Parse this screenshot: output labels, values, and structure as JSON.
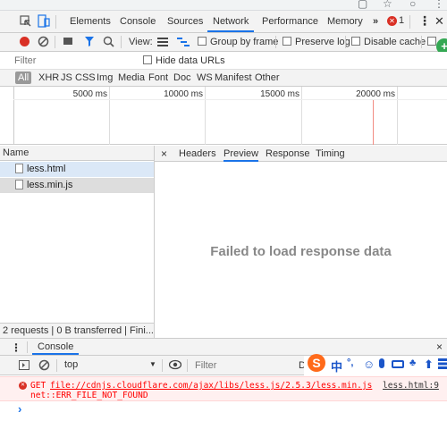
{
  "chrome": {
    "star_icon": "star",
    "account_icon": "account",
    "menu_icon": "more"
  },
  "devtools_tabs": [
    "Elements",
    "Console",
    "Sources",
    "Network",
    "Performance",
    "Memory"
  ],
  "active_tab": "Network",
  "more_tabs": "»",
  "error_count": "1",
  "toolbar": {
    "view_label": "View:",
    "group_by_frame": "Group by frame",
    "preserve_log": "Preserve log",
    "disable_cache": "Disable cache"
  },
  "filter": {
    "placeholder": "Filter",
    "hide_data_urls": "Hide data URLs"
  },
  "type_filters": [
    "All",
    "XHR",
    "JS",
    "CSS",
    "Img",
    "Media",
    "Font",
    "Doc",
    "WS",
    "Manifest",
    "Other"
  ],
  "timeline": {
    "ticks": [
      "5000 ms",
      "10000 ms",
      "15000 ms",
      "20000 ms"
    ]
  },
  "requests": {
    "header": "Name",
    "files": [
      "less.html",
      "less.min.js"
    ],
    "status": "2 requests | 0 B transferred | Fini..."
  },
  "detail_tabs": {
    "close": "×",
    "tabs": [
      "Headers",
      "Preview",
      "Response",
      "Timing"
    ],
    "active": "Preview"
  },
  "preview_message": "Failed to load response data",
  "drawer": {
    "tab": "Console",
    "close": "×"
  },
  "console": {
    "context": "top",
    "filter_placeholder": "Filter",
    "filter_extra": "De",
    "error_method": "GET",
    "error_url": "file://cdnjs.cloudflare.com/ajax/libs/less.js/2.5.3/less.min.js",
    "error_source": "less.html:9",
    "error_detail": "net::ERR_FILE_NOT_FOUND",
    "prompt": "›"
  },
  "ime": {
    "logo": "S",
    "chinese": "中",
    "punct": "°,"
  },
  "colors": {
    "accent": "#1a73e8",
    "error": "#f00",
    "record": "#d93025"
  }
}
